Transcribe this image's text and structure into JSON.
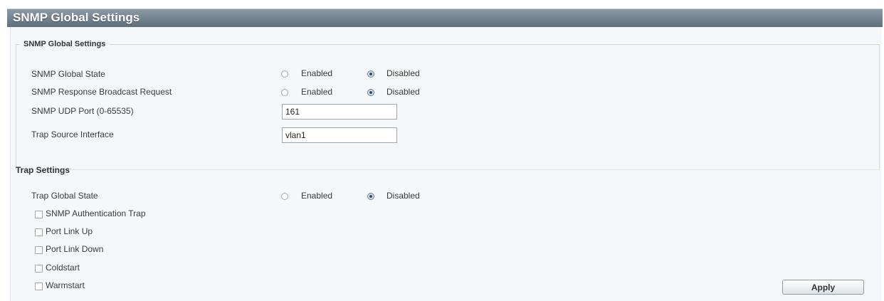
{
  "page_title": "SNMP Global Settings",
  "global_section": {
    "legend": "SNMP Global Settings",
    "rows": {
      "global_state": {
        "label": "SNMP Global State",
        "enabled_label": "Enabled",
        "disabled_label": "Disabled",
        "selected": "Disabled"
      },
      "broadcast_request": {
        "label": "SNMP Response Broadcast Request",
        "enabled_label": "Enabled",
        "disabled_label": "Disabled",
        "selected": "Disabled"
      },
      "udp_port": {
        "label": "SNMP UDP Port (0-65535)",
        "value": "161"
      },
      "trap_source": {
        "label": "Trap Source Interface",
        "value": "vlan1"
      }
    }
  },
  "trap_section": {
    "title": "Trap Settings",
    "global_state": {
      "label": "Trap Global State",
      "enabled_label": "Enabled",
      "disabled_label": "Disabled",
      "selected": "Disabled"
    },
    "checkboxes": {
      "auth_trap": {
        "label": "SNMP Authentication Trap",
        "checked": false
      },
      "link_up": {
        "label": "Port Link Up",
        "checked": false
      },
      "link_down": {
        "label": "Port Link Down",
        "checked": false
      },
      "coldstart": {
        "label": "Coldstart",
        "checked": false
      },
      "warmstart": {
        "label": "Warmstart",
        "checked": false
      }
    }
  },
  "apply_label": "Apply"
}
